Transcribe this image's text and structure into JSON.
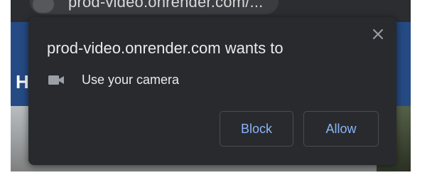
{
  "browser": {
    "omnibox_url": "prod-video.onrender.com/..."
  },
  "page": {
    "partial_heading": "H"
  },
  "dialog": {
    "title": "prod-video.onrender.com wants to",
    "permission": {
      "icon": "camera-icon",
      "label": "Use your camera"
    },
    "buttons": {
      "block_label": "Block",
      "allow_label": "Allow"
    },
    "close_icon": "close-icon",
    "colors": {
      "background": "#292a2d",
      "text": "#e8eaed",
      "button_text": "#8ab4f8",
      "button_border": "#4a4c50"
    }
  }
}
